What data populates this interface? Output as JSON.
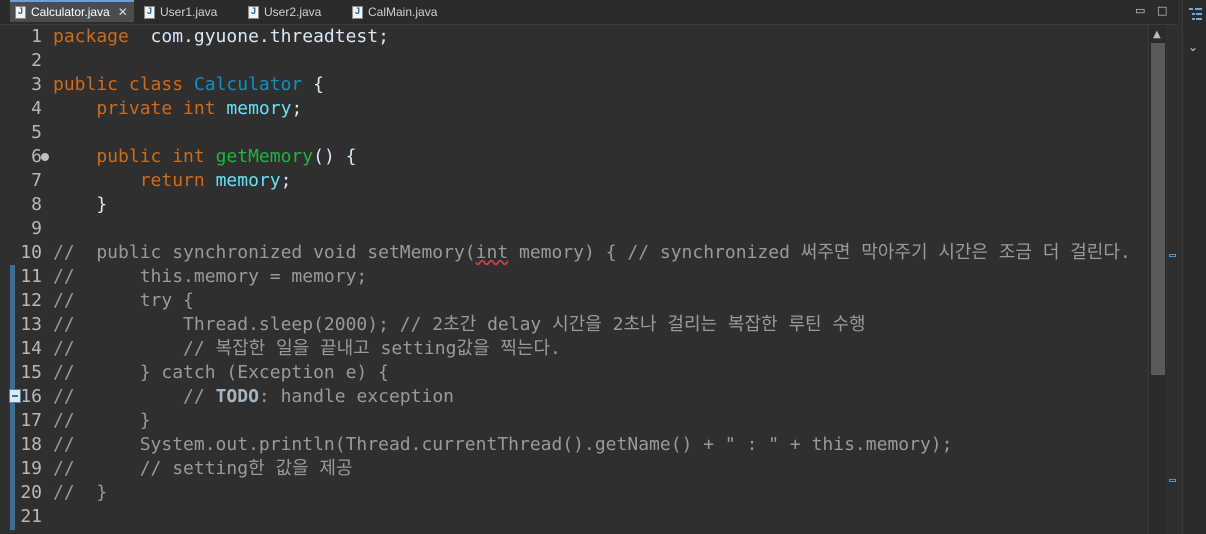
{
  "tabs": [
    {
      "label": "Calculator.java",
      "active": true,
      "closable": true
    },
    {
      "label": "User1.java",
      "active": false
    },
    {
      "label": "User2.java",
      "active": false
    },
    {
      "label": "CalMain.java",
      "active": false
    }
  ],
  "window_controls": {
    "minimize": "▭",
    "maximize": "□"
  },
  "side_panel": {
    "chevron": "⌄"
  },
  "colors": {
    "keyword": "#cc6c1d",
    "class": "#1290c3",
    "field": "#66e1f8",
    "method": "#1eb540",
    "comment": "#9a9a9a",
    "text": "#d9e8f7"
  },
  "lines": [
    {
      "n": "1",
      "parts": [
        [
          "kw",
          "package"
        ],
        [
          "",
          "  com.gyuone.threadtest;"
        ]
      ]
    },
    {
      "n": "2",
      "parts": []
    },
    {
      "n": "3",
      "parts": [
        [
          "kw",
          "public class "
        ],
        [
          "cls",
          "Calculator"
        ],
        [
          "",
          " {"
        ]
      ]
    },
    {
      "n": "4",
      "parts": [
        [
          "",
          "    "
        ],
        [
          "kw",
          "private int "
        ],
        [
          "fld",
          "memory"
        ],
        [
          "",
          ";"
        ]
      ]
    },
    {
      "n": "5",
      "parts": []
    },
    {
      "n": "6",
      "fold": true,
      "parts": [
        [
          "",
          "    "
        ],
        [
          "kw",
          "public int "
        ],
        [
          "mth",
          "getMemory"
        ],
        [
          "",
          "() {"
        ]
      ]
    },
    {
      "n": "7",
      "parts": [
        [
          "",
          "        "
        ],
        [
          "kw",
          "return "
        ],
        [
          "fld",
          "memory"
        ],
        [
          "",
          ";"
        ]
      ]
    },
    {
      "n": "8",
      "parts": [
        [
          "",
          "    }"
        ]
      ]
    },
    {
      "n": "9",
      "parts": []
    },
    {
      "n": "10",
      "parts": [
        [
          "cmt",
          "//  public synchronized void setMemory("
        ],
        [
          "cmt err",
          "int"
        ],
        [
          "cmt",
          " memory) { // synchronized 써주면 막아주기 시간은 조금 더 걸린다."
        ]
      ]
    },
    {
      "n": "11",
      "parts": [
        [
          "cmt",
          "//      this.memory = memory;"
        ]
      ]
    },
    {
      "n": "12",
      "parts": [
        [
          "cmt",
          "//      try {"
        ]
      ]
    },
    {
      "n": "13",
      "parts": [
        [
          "cmt",
          "//          Thread.sleep(2000); // 2초간 delay 시간을 2초나 걸리는 복잡한 루틴 수행"
        ]
      ]
    },
    {
      "n": "14",
      "parts": [
        [
          "cmt",
          "//          // 복잡한 일을 끝내고 setting값을 찍는다."
        ]
      ]
    },
    {
      "n": "15",
      "parts": [
        [
          "cmt",
          "//      } catch (Exception e) {"
        ]
      ]
    },
    {
      "n": "16",
      "task": true,
      "parts": [
        [
          "cmt",
          "//          // "
        ],
        [
          "todo",
          "TODO"
        ],
        [
          "cmt",
          ": handle exception"
        ]
      ]
    },
    {
      "n": "17",
      "parts": [
        [
          "cmt",
          "//      }"
        ]
      ]
    },
    {
      "n": "18",
      "parts": [
        [
          "cmt",
          "//      System.out.println(Thread.currentThread().getName() + \" : \" + this.memory);"
        ]
      ]
    },
    {
      "n": "19",
      "parts": [
        [
          "cmt",
          "//      // setting한 값을 제공"
        ]
      ]
    },
    {
      "n": "20",
      "parts": [
        [
          "cmt",
          "//  }"
        ]
      ]
    },
    {
      "n": "21",
      "parts": []
    }
  ]
}
